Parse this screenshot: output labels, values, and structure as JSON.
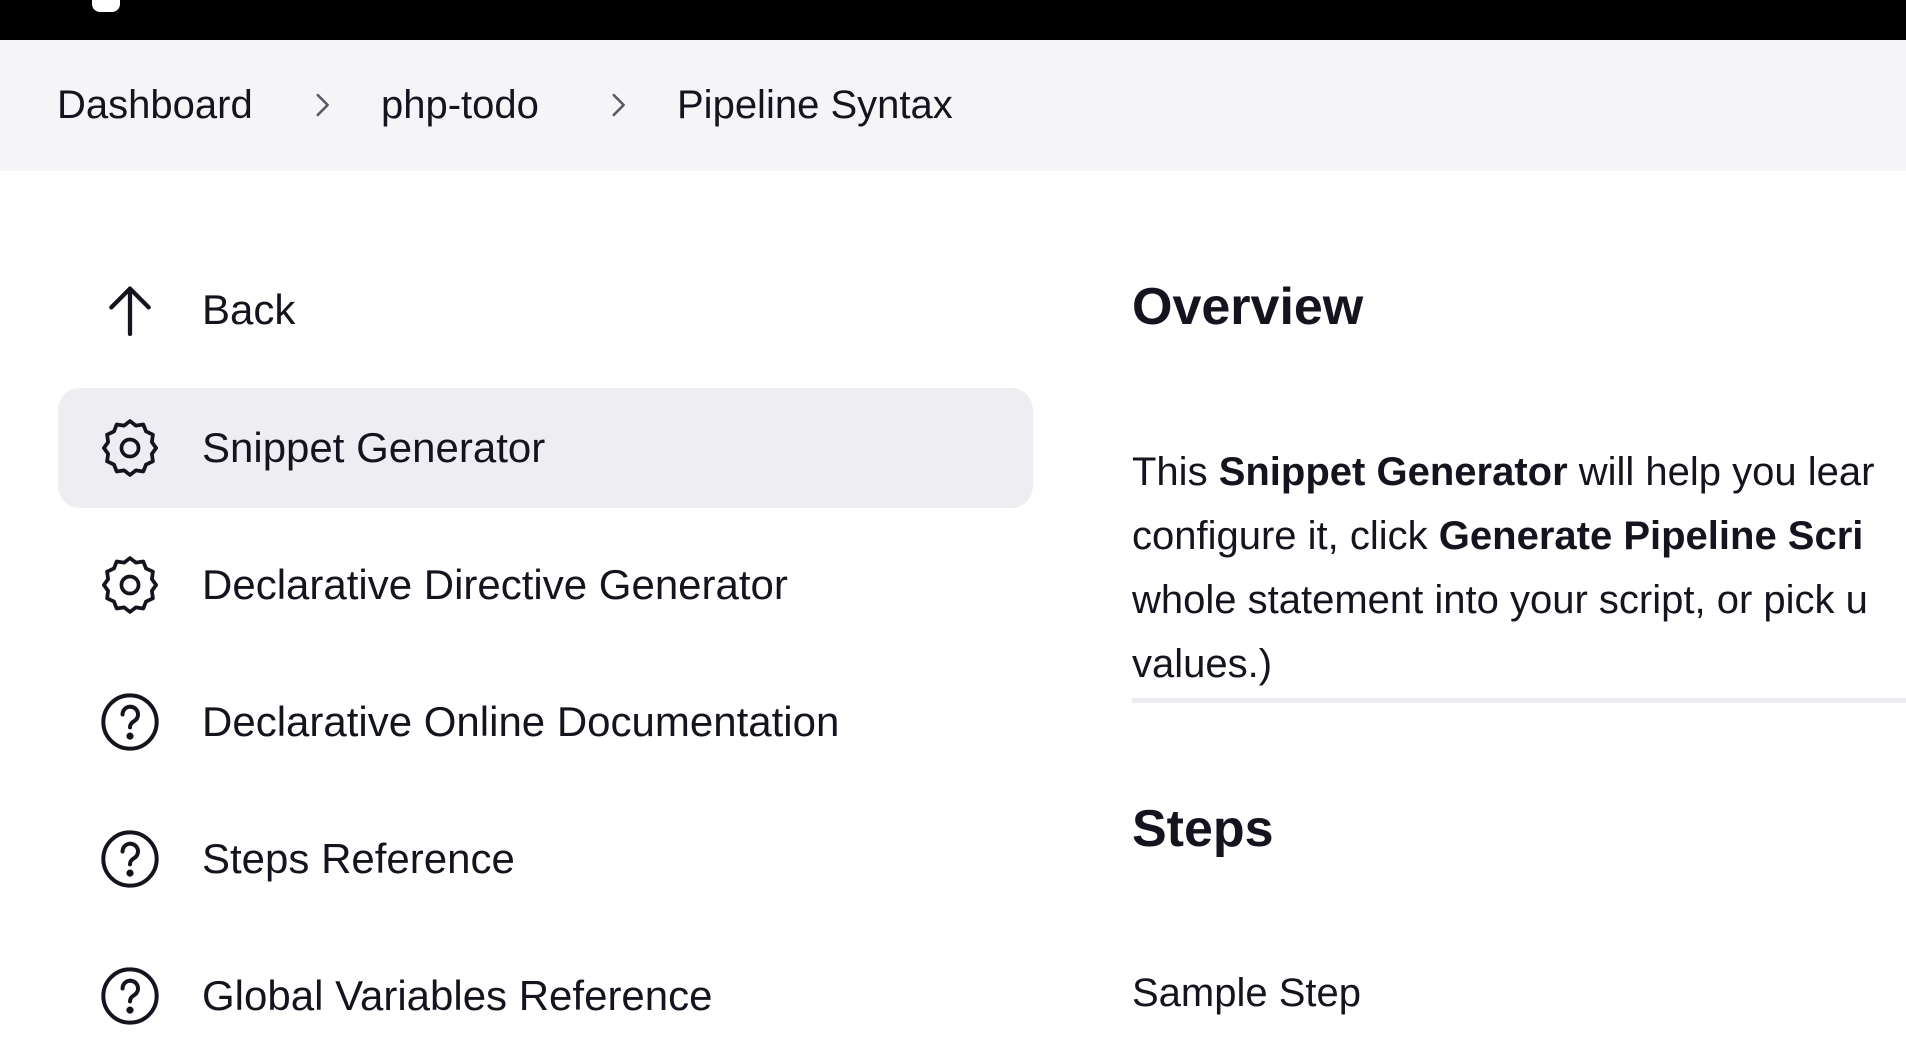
{
  "breadcrumb": {
    "items": [
      {
        "label": "Dashboard"
      },
      {
        "label": "php-todo"
      },
      {
        "label": "Pipeline Syntax"
      }
    ]
  },
  "sidebar": {
    "items": [
      {
        "label": "Back",
        "icon": "arrow-up-icon",
        "active": false
      },
      {
        "label": "Snippet Generator",
        "icon": "gear-icon",
        "active": true
      },
      {
        "label": "Declarative Directive Generator",
        "icon": "gear-icon",
        "active": false
      },
      {
        "label": "Declarative Online Documentation",
        "icon": "help-circle-icon",
        "active": false
      },
      {
        "label": "Steps Reference",
        "icon": "help-circle-icon",
        "active": false
      },
      {
        "label": "Global Variables Reference",
        "icon": "help-circle-icon",
        "active": false
      }
    ]
  },
  "main": {
    "overview_heading": "Overview",
    "paragraph": {
      "line1_a": "This ",
      "line1_b": "Snippet Generator",
      "line1_c": " will help you lear",
      "line2_a": "configure it, click ",
      "line2_b": "Generate Pipeline Scri",
      "line3": "whole statement into your script, or pick u",
      "line4": "values.)"
    },
    "steps_heading": "Steps",
    "sample_step_label": "Sample Step"
  },
  "colors": {
    "topbar": "#000000",
    "breadcrumb_bg": "#f5f5f7",
    "active_item_bg": "#eeeef2",
    "text": "#14141f"
  }
}
